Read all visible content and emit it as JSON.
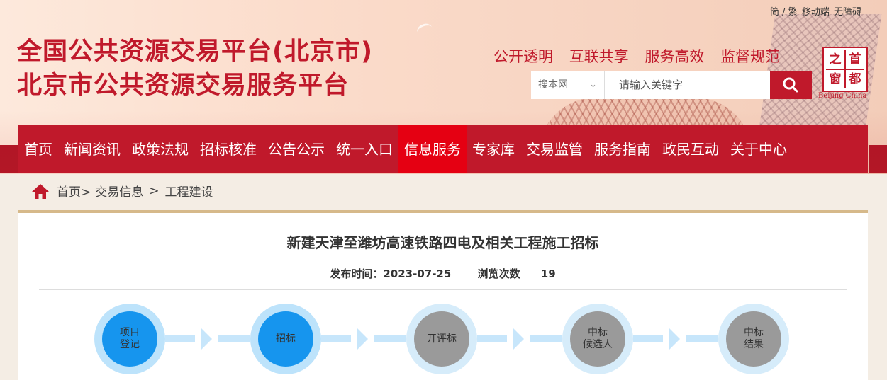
{
  "top_links": {
    "simplified_traditional": "简 / 繁",
    "mobile": "移动端",
    "accessibility": "无障碍"
  },
  "site": {
    "title_line1": "全国公共资源交易平台(北京市)",
    "title_line2": "北京市公共资源交易服务平台",
    "slogans": [
      "公开透明",
      "互联共享",
      "服务高效",
      "监督规范"
    ],
    "seal_chars": [
      "之",
      "首",
      "窗",
      "都"
    ],
    "seal_english": "Beijing China"
  },
  "search": {
    "scope": "搜本网",
    "placeholder": "请输入关键字"
  },
  "nav": {
    "items": [
      "首页",
      "新闻资讯",
      "政策法规",
      "招标核准",
      "公告公示",
      "统一入口",
      "信息服务",
      "专家库",
      "交易监管",
      "服务指南",
      "政民互动",
      "关于中心"
    ],
    "active": "信息服务"
  },
  "breadcrumb": {
    "items": [
      "首页>",
      "交易信息",
      ">",
      "工程建设"
    ]
  },
  "article": {
    "title": "新建天津至潍坊高速铁路四电及相关工程施工招标",
    "publish_label": "发布时间：",
    "publish_date": "2023-07-25",
    "views_label": "浏览次数",
    "views": "19"
  },
  "steps": [
    {
      "label": "项目\n登记",
      "status": "done"
    },
    {
      "label": "招标",
      "status": "done"
    },
    {
      "label": "开评标",
      "status": "todo"
    },
    {
      "label": "中标\n候选人",
      "status": "todo"
    },
    {
      "label": "中标\n结果",
      "status": "todo"
    }
  ],
  "colors": {
    "brand_red": "#c0192b",
    "nav_active": "#e50012",
    "step_done": "#1695ee",
    "step_todo": "#9a9a9a"
  }
}
